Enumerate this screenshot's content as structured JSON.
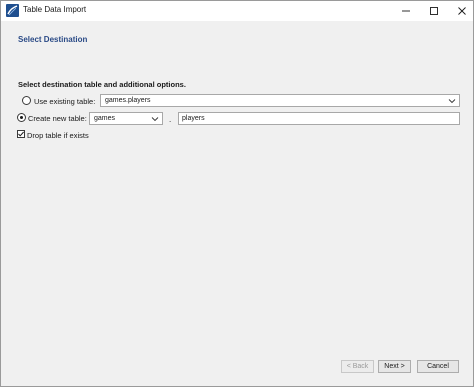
{
  "window": {
    "title": "Table Data Import",
    "icons": {
      "app": "mysql-workbench-icon",
      "minimize": "minimize-icon",
      "maximize": "maximize-icon",
      "close": "close-icon"
    }
  },
  "page": {
    "title": "Select Destination",
    "subheading": "Select destination table and additional options."
  },
  "options": {
    "use_existing": {
      "label": "Use existing table:",
      "selected": false,
      "value": "games.players"
    },
    "create_new": {
      "label": "Create new table:",
      "selected": true,
      "schema": "games",
      "separator": ".",
      "table_name": "players"
    },
    "drop_table": {
      "label": "Drop table if exists",
      "checked": true
    }
  },
  "buttons": {
    "back": "< Back",
    "next": "Next >",
    "cancel": "Cancel"
  }
}
